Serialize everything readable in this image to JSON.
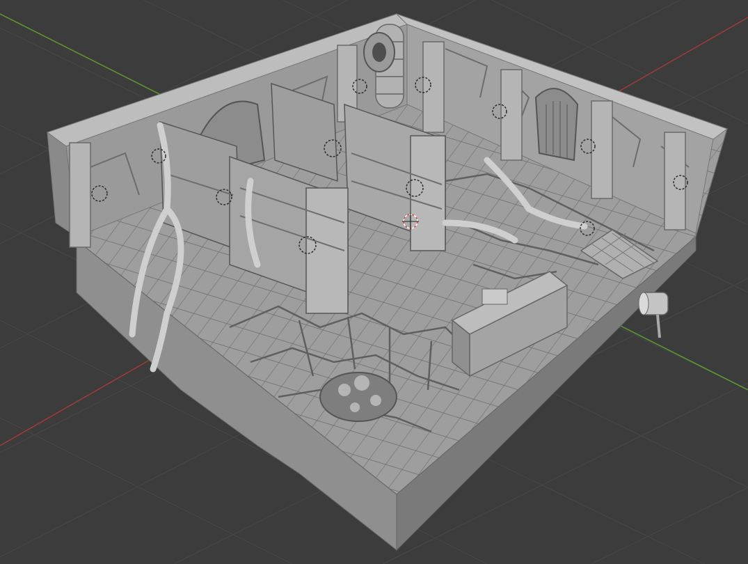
{
  "viewport": {
    "shading": "solid",
    "background_color": "#3c3c3c",
    "grid_color": "#474747",
    "x_axis_color": "#a33a3a",
    "y_axis_color": "#5f9a2f",
    "model_color": "#8a8a8a",
    "light_gizmo_icon": "light-gizmo-icon",
    "cursor_icon": "3d-cursor-icon"
  },
  "scene": {
    "objects": [
      "room-floor-base",
      "stone-walls",
      "bookshelves",
      "ceiling-pipe",
      "arched-doors",
      "tentacle-roots",
      "wooden-counter",
      "mushroom-patch",
      "small-barrel-prop"
    ]
  }
}
